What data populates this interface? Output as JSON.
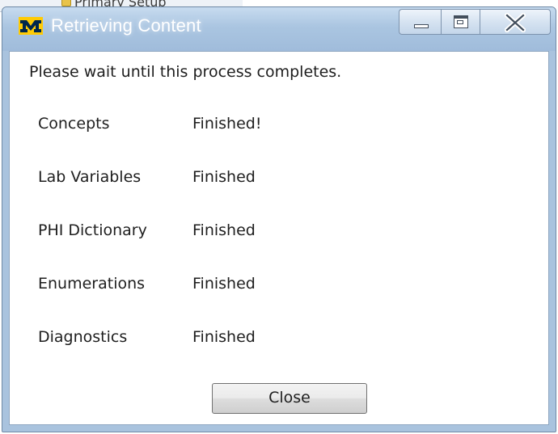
{
  "background_window": {
    "partial_text": "Primary Setup"
  },
  "dialog": {
    "title": "Retrieving Content",
    "app_logo": "michigan-m-logo",
    "caption_buttons": [
      "minimize-icon",
      "maximize-icon",
      "close-icon"
    ],
    "instruction": "Please wait until this process completes.",
    "statuses": [
      {
        "name": "Concepts",
        "status": "Finished!"
      },
      {
        "name": "Lab Variables",
        "status": "Finished"
      },
      {
        "name": "PHI Dictionary",
        "status": "Finished"
      },
      {
        "name": "Enumerations",
        "status": "Finished"
      },
      {
        "name": "Diagnostics",
        "status": "Finished"
      }
    ],
    "close_label": "Close"
  },
  "colors": {
    "title_bar": "#a9c3de",
    "logo_blue": "#00274c",
    "logo_maize": "#ffcb05"
  }
}
